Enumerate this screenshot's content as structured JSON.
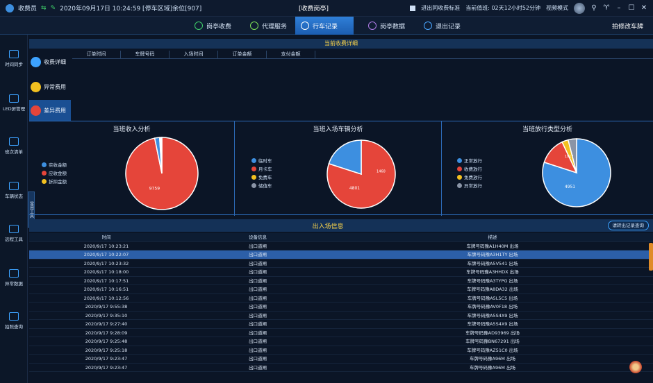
{
  "titlebar": {
    "user": "收费员",
    "info": "2020年09月17日 10:24:59 [停车区域]余位[907]",
    "center": "[收费岗亭]",
    "checkbox_label": "进出同收费标准",
    "stats": "当前值班: 02天12小时52分钟",
    "mode": "视频模式"
  },
  "tabs": [
    {
      "label": "岗亭收费",
      "color": "#3fd06a"
    },
    {
      "label": "代理服务",
      "color": "#7ee057"
    },
    {
      "label": "行车记录",
      "color": "#ffffff"
    },
    {
      "label": "岗亭数据",
      "color": "#b07ce8"
    },
    {
      "label": "退出记录",
      "color": "#4aa6ff"
    }
  ],
  "user_link": "拍修改车牌",
  "sidebar": [
    {
      "label": "时间同步"
    },
    {
      "label": "LED屏管理"
    },
    {
      "label": "班次清单"
    },
    {
      "label": "车辆状态"
    },
    {
      "label": "远程工具"
    },
    {
      "label": "异常数据"
    },
    {
      "label": "拍照查询"
    }
  ],
  "vtab_label": "常用工具",
  "subnav": [
    {
      "label": "收费详细",
      "color": "#3da2ff"
    },
    {
      "label": "异常费用",
      "color": "#f2c020"
    },
    {
      "label": "差异费用",
      "color": "#e5453a"
    }
  ],
  "detail": {
    "title": "当前收费详细",
    "columns": [
      "订单时间",
      "车牌号码",
      "入场时间",
      "订单金额",
      "支付金额"
    ]
  },
  "panels": [
    {
      "title": "当班收入分析",
      "legend": [
        {
          "label": "实收金额",
          "color": "#3d8fe0"
        },
        {
          "label": "应收金额",
          "color": "#e5453a"
        },
        {
          "label": "折扣金额",
          "color": "#f2c020"
        }
      ],
      "slices": [
        {
          "value": 96.8,
          "color": "#e5453a"
        },
        {
          "value": 2.2,
          "color": "#3d8fe0"
        },
        {
          "value": 1.0,
          "color": "#ffffff"
        }
      ],
      "big_label": "9759"
    },
    {
      "title": "当班入场车辆分析",
      "legend": [
        {
          "label": "临时车",
          "color": "#3d8fe0"
        },
        {
          "label": "月卡车",
          "color": "#e5453a"
        },
        {
          "label": "免费车",
          "color": "#f2c020"
        },
        {
          "label": "储值车",
          "color": "#8a94a6"
        }
      ],
      "slices": [
        {
          "value": 80,
          "color": "#e5453a"
        },
        {
          "value": 20,
          "color": "#3d8fe0"
        }
      ],
      "big_label": "4801",
      "small_label": "1468"
    },
    {
      "title": "当班放行类型分析",
      "legend": [
        {
          "label": "正常放行",
          "color": "#3d8fe0"
        },
        {
          "label": "收费放行",
          "color": "#e5453a"
        },
        {
          "label": "免费放行",
          "color": "#f2c020"
        },
        {
          "label": "异常放行",
          "color": "#8a94a6"
        }
      ],
      "slices": [
        {
          "value": 80,
          "color": "#3d8fe0"
        },
        {
          "value": 13,
          "color": "#e5453a"
        },
        {
          "value": 3,
          "color": "#f2c020"
        },
        {
          "value": 4,
          "color": "#8a94a6"
        }
      ],
      "big_label": "4951",
      "small_label": "1017"
    }
  ],
  "io": {
    "title": "出入场信息",
    "button": "请转出记录查询",
    "headers": [
      "时间",
      "设备信息",
      "描述"
    ],
    "rows": [
      {
        "time": "2020/9/17 10:23:21",
        "device": "出口道闸",
        "desc": "车牌号码豫A1H40M 出场",
        "sel": false
      },
      {
        "time": "2020/9/17 10:22:07",
        "device": "出口道闸",
        "desc": "车牌号码豫A3H1TY 出场",
        "sel": true
      },
      {
        "time": "2020/9/17 10:23:32",
        "device": "出口道闸",
        "desc": "车牌号码豫A5V541 出场",
        "sel": false
      },
      {
        "time": "2020/9/17 10:18:00",
        "device": "出口道闸",
        "desc": "车牌号码豫A3HHDX 出场",
        "sel": false
      },
      {
        "time": "2020/9/17 10:17:51",
        "device": "出口道闸",
        "desc": "车牌号码豫A3TYPG 出场",
        "sel": false
      },
      {
        "time": "2020/9/17 10:16:51",
        "device": "出口道闸",
        "desc": "车牌号码豫A8DA32 出场",
        "sel": false
      },
      {
        "time": "2020/9/17 10:12:56",
        "device": "出口道闸",
        "desc": "车牌号码豫A5L5C5 出场",
        "sel": false
      },
      {
        "time": "2020/9/17 9:55:38",
        "device": "出口道闸",
        "desc": "车牌号码豫AV0F18 出场",
        "sel": false
      },
      {
        "time": "2020/9/17 9:35:10",
        "device": "出口道闸",
        "desc": "车牌号码豫A5S4X9 出场",
        "sel": false
      },
      {
        "time": "2020/9/17 9:27:40",
        "device": "出口道闸",
        "desc": "车牌号码豫A5S4X9 出场",
        "sel": false
      },
      {
        "time": "2020/9/17 9:28:09",
        "device": "出口道闸",
        "desc": "车牌号码豫AD93969 出场",
        "sel": false
      },
      {
        "time": "2020/9/17 9:25:48",
        "device": "出口道闸",
        "desc": "车牌号码豫BN67291 出场",
        "sel": false
      },
      {
        "time": "2020/9/17 9:25:18",
        "device": "出口道闸",
        "desc": "车牌号码豫AZ51C0 出场",
        "sel": false
      },
      {
        "time": "2020/9/17 9:23:47",
        "device": "出口道闸",
        "desc": "车牌号码豫A96M 出场",
        "sel": false
      },
      {
        "time": "2020/9/17 9:23:47",
        "device": "出口道闸",
        "desc": "车牌号码豫A96M 出场",
        "sel": false
      }
    ]
  }
}
